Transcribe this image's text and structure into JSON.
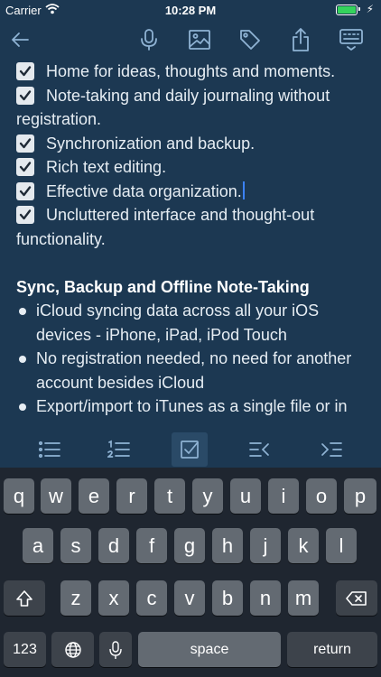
{
  "status_bar": {
    "carrier": "Carrier",
    "time": "10:28 PM"
  },
  "toolbar": {
    "icons": [
      "back-arrow-icon",
      "microphone-icon",
      "image-icon",
      "tag-icon",
      "share-icon",
      "keyboard-dismiss-icon"
    ],
    "icon_color": "#8fb3d4"
  },
  "note": {
    "checklist": [
      "Home for ideas, thoughts and moments.",
      "Note-taking and daily journaling without registration.",
      "Synchronization and backup.",
      "Rich text editing.",
      "Effective data organization.",
      "Uncluttered interface and thought-out functionality."
    ],
    "section_heading": "Sync, Backup and Offline Note-Taking",
    "bullets": [
      "iCloud syncing data across all your iOS devices - iPhone, iPad, iPod Touch",
      "No registration needed, no need for another account besides iCloud",
      "Export/import to iTunes as a single file or in"
    ]
  },
  "format_bar": {
    "icons": [
      "bulleted-list-icon",
      "numbered-list-icon",
      "checkbox-icon",
      "outdent-icon",
      "indent-icon"
    ],
    "active": "checkbox-icon"
  },
  "keyboard": {
    "row1": [
      "q",
      "w",
      "e",
      "r",
      "t",
      "y",
      "u",
      "i",
      "o",
      "p"
    ],
    "row2": [
      "a",
      "s",
      "d",
      "f",
      "g",
      "h",
      "j",
      "k",
      "l"
    ],
    "row3": [
      "z",
      "x",
      "c",
      "v",
      "b",
      "n",
      "m"
    ],
    "numbers_label": "123",
    "space_label": "space",
    "return_label": "return"
  },
  "colors": {
    "background": "#1c3852",
    "accent": "#3b82f6",
    "keyboard": "#1f2630"
  }
}
